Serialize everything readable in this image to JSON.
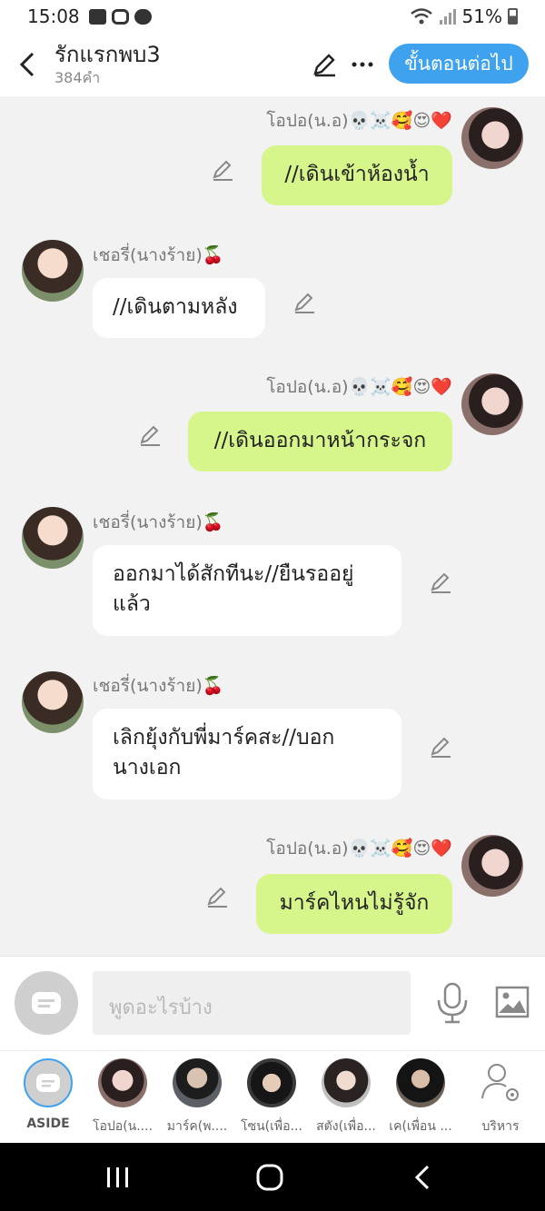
{
  "status": {
    "time": "15:08",
    "battery": "51%",
    "icons": [
      "gallery-icon",
      "instagram-icon",
      "line-app-icon",
      "wifi-icon",
      "signal-icon",
      "battery-icon"
    ]
  },
  "header": {
    "title": "รักแรกพบ3",
    "subtitle": "384คำ",
    "next_label": "ขั้นตอนต่อไป",
    "accent": "#3ea2ef"
  },
  "chat": {
    "messages": [
      {
        "side": "right",
        "name": "โอปอ(น.อ)💀☠️🥰😍❤️",
        "text": "//เดินเข้าห้องน้ำ"
      },
      {
        "side": "left",
        "name": "เชอรี่(นางร้าย)🍒",
        "text": "//เดินตามหลัง"
      },
      {
        "side": "right",
        "name": "โอปอ(น.อ)💀☠️🥰😍❤️",
        "text": "//เดินออกมาหน้ากระจก"
      },
      {
        "side": "left",
        "name": "เชอรี่(นางร้าย)🍒",
        "text": "ออกมาได้สักทีนะ//ยืนรออยู่แล้ว"
      },
      {
        "side": "left",
        "name": "เชอรี่(นางร้าย)🍒",
        "text": "เลิกยุ้งกับพี่มาร์คสะ//บอกนางเอก"
      },
      {
        "side": "right",
        "name": "โอปอ(น.อ)💀☠️🥰😍❤️",
        "text": "มาร์คไหนไม่รู้จัก"
      }
    ],
    "bubble_right_color": "#d6f58a",
    "bubble_left_color": "#ffffff"
  },
  "input": {
    "placeholder": "พูดอะไรบ้าง"
  },
  "tabs": [
    {
      "label": "ASIDE"
    },
    {
      "label": "โอปอ(น...."
    },
    {
      "label": "มาร์ค(พ...."
    },
    {
      "label": "โซน(เพื่อ..."
    },
    {
      "label": "สตัง(เพื่อ..."
    },
    {
      "label": "เค(เพื่อน ..."
    },
    {
      "label": "บริหาร"
    }
  ]
}
